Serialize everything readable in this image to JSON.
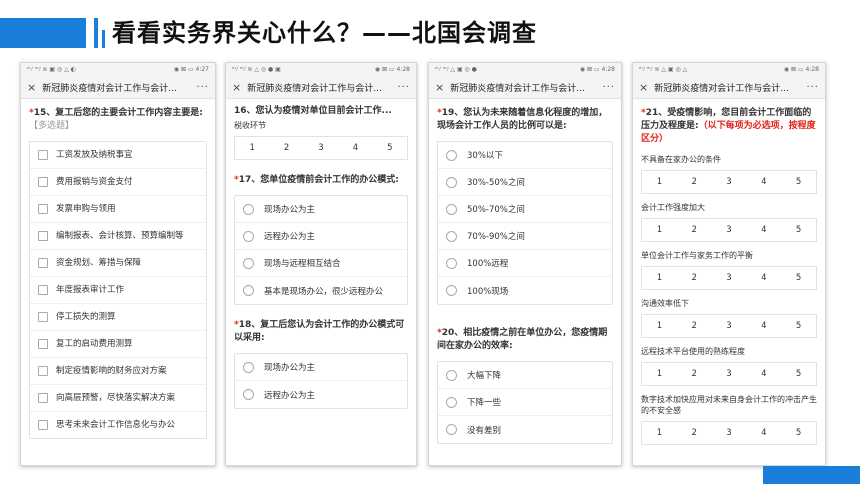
{
  "slide": {
    "title": "看看实务界关心什么？——北国会调查"
  },
  "phones": [
    {
      "status_left": "ᵐᵢˡ ᵐᵢˡ ≋ ▣ ◎ △ ◐",
      "status_right": "◉ ⊠ ▭ 4:27",
      "nav_title": "新冠肺炎疫情对会计工作与会计...",
      "q15": {
        "req": "*",
        "text": "15、复工后您的主要会计工作内容主要是:",
        "hint": "【多选题】"
      },
      "options": [
        "工资发放及纳税事宜",
        "费用报销与资金支付",
        "发票申购与领用",
        "编制报表、会计核算、预算编制等",
        "资金规划、筹措与保障",
        "年度报表审计工作",
        "停工损失的测算",
        "复工的启动费用测算",
        "制定疫情影响的财务应对方案",
        "向高层预警，尽快落实解决方案",
        "思考未来会计工作信息化与办公"
      ]
    },
    {
      "status_left": "ᵐᵢˡ ᵐᵢˡ ≋ △ ◎ ● ▣",
      "status_right": "◉ ⊠ ▭ 4:28",
      "nav_title": "新冠肺炎疫情对会计工作与会计...",
      "q16": {
        "text": "16、您认为疫情对单位目前会计工作...",
        "sub": "税收环节",
        "scale": [
          "1",
          "2",
          "3",
          "4",
          "5"
        ]
      },
      "q17": {
        "req": "*",
        "text": "17、您单位疫情前会计工作的办公模式:",
        "options": [
          "现场办公为主",
          "远程办公为主",
          "现场与远程相互结合",
          "基本是现场办公，很少远程办公"
        ]
      },
      "q18": {
        "req": "*",
        "text": "18、复工后您认为会计工作的办公模式可以采用:",
        "options": [
          "现场办公为主",
          "远程办公为主"
        ]
      }
    },
    {
      "status_left": "ᵐᵢˡ ᵐᵢˡ △ ▣ ◎ ●",
      "status_right": "◉ ⊠ ▭ 4:28",
      "nav_title": "新冠肺炎疫情对会计工作与会计...",
      "q19": {
        "req": "*",
        "text": "19、您认为未来随着信息化程度的增加，现场会计工作人员的比例可以是:",
        "options": [
          "30%以下",
          "30%-50%之间",
          "50%-70%之间",
          "70%-90%之间",
          "100%远程",
          "100%现场"
        ]
      },
      "q20": {
        "req": "*",
        "text": "20、相比疫情之前在单位办公，您疫情期间在家办公的效率:",
        "options": [
          "大幅下降",
          "下降一些",
          "没有差别"
        ]
      }
    },
    {
      "status_left": "ᵐᵢˡ ᵐᵢˡ ≋ △ ▣ ◎ △",
      "status_right": "◉ ⊠ ▭ 4:28",
      "nav_title": "新冠肺炎疫情对会计工作与会计...",
      "q21": {
        "req": "*",
        "text": "21、受疫情影响，您目前会计工作面临的压力及程度是:",
        "hint": "（以下每项为必选项，按程度区分）",
        "items": [
          "不具备在家办公的条件",
          "会计工作强度加大",
          "单位会计工作与家务工作的平衡",
          "沟通效率低下",
          "远程技术平台使用的熟练程度",
          "数字技术加快应用对未来自身会计工作的冲击产生的不安全感"
        ],
        "scale": [
          "1",
          "2",
          "3",
          "4",
          "5"
        ]
      }
    }
  ],
  "icons": {
    "close": "×",
    "more": "···"
  },
  "colors": {
    "accent": "#1a7fd9",
    "required": "#e2231a"
  }
}
